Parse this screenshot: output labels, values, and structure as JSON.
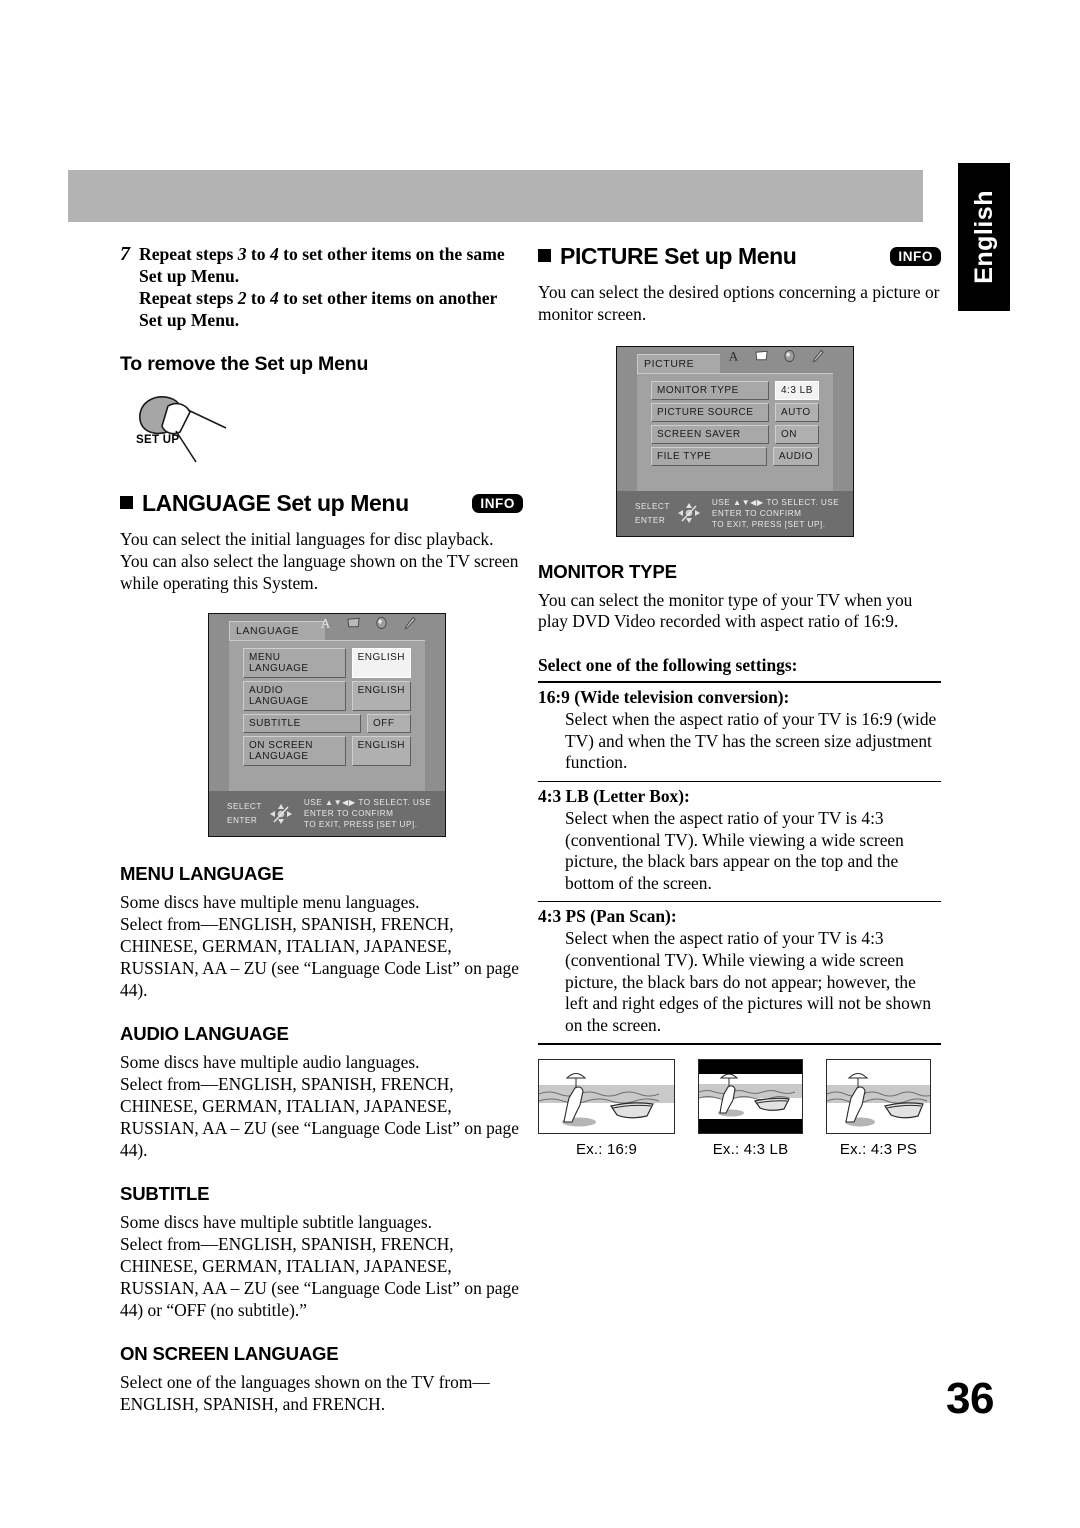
{
  "page": {
    "number": "36",
    "language_tab": "English"
  },
  "left": {
    "step7": {
      "num": "7",
      "line1_a": "Repeat steps ",
      "line1_n1": "3",
      "line1_b": " to ",
      "line1_n2": "4",
      "line1_c": " to set other items on the same Set up Menu.",
      "line2_a": "Repeat steps ",
      "line2_n1": "2",
      "line2_b": " to ",
      "line2_n2": "4",
      "line2_c": " to set other items on another Set up Menu."
    },
    "remove_heading": "To remove the Set up Menu",
    "setup_button_label": "SET UP",
    "language_section": {
      "title": "LANGUAGE Set up Menu",
      "info_badge": "INFO",
      "intro": "You can select the initial languages for disc playback. You can also select the language shown on the TV screen while operating this System."
    },
    "language_osd": {
      "tab_title": "LANGUAGE",
      "rows": [
        {
          "key": "MENU LANGUAGE",
          "value": "ENGLISH",
          "selected": true
        },
        {
          "key": "AUDIO LANGUAGE",
          "value": "ENGLISH",
          "selected": false
        },
        {
          "key": "SUBTITLE",
          "value": "OFF",
          "selected": false
        },
        {
          "key": "ON SCREEN LANGUAGE",
          "value": "ENGLISH",
          "selected": false
        }
      ],
      "footer": {
        "select_label": "SELECT",
        "enter_label": "ENTER",
        "line1": "USE ▲▼◀▶ TO SELECT.  USE ENTER TO CONFIRM",
        "line2": "TO EXIT, PRESS [SET UP]."
      },
      "active_tab_index": 0
    },
    "menu_language": {
      "heading": "MENU LANGUAGE",
      "line1": "Some discs have multiple menu languages.",
      "line2": "Select from—ENGLISH, SPANISH, FRENCH, CHINESE, GERMAN, ITALIAN, JAPANESE, RUSSIAN, AA – ZU (see “Language Code List” on page 44)."
    },
    "audio_language": {
      "heading": "AUDIO LANGUAGE",
      "line1": "Some discs have multiple audio languages.",
      "line2": "Select from—ENGLISH, SPANISH, FRENCH, CHINESE, GERMAN, ITALIAN, JAPANESE, RUSSIAN, AA – ZU (see “Language Code List” on page 44)."
    },
    "subtitle": {
      "heading": "SUBTITLE",
      "line1": "Some discs have multiple subtitle languages.",
      "line2": "Select from—ENGLISH, SPANISH, FRENCH, CHINESE, GERMAN, ITALIAN, JAPANESE, RUSSIAN, AA – ZU (see “Language Code List” on page 44) or “OFF (no subtitle).”"
    },
    "on_screen_language": {
      "heading": "ON SCREEN LANGUAGE",
      "line1": "Select one of the languages shown on the TV from—ENGLISH, SPANISH, and FRENCH."
    }
  },
  "right": {
    "picture_section": {
      "title": "PICTURE Set up Menu",
      "info_badge": "INFO",
      "intro": "You can select the desired options concerning a picture or monitor screen."
    },
    "picture_osd": {
      "tab_title": "PICTURE",
      "rows": [
        {
          "key": "MONITOR TYPE",
          "value": "4:3 LB",
          "selected": true
        },
        {
          "key": "PICTURE SOURCE",
          "value": "AUTO",
          "selected": false
        },
        {
          "key": "SCREEN SAVER",
          "value": "ON",
          "selected": false
        },
        {
          "key": "FILE TYPE",
          "value": "AUDIO",
          "selected": false
        }
      ],
      "footer": {
        "select_label": "SELECT",
        "enter_label": "ENTER",
        "line1": "USE ▲▼◀▶ TO SELECT.  USE ENTER TO CONFIRM",
        "line2": "TO EXIT, PRESS [SET UP]."
      },
      "active_tab_index": 1
    },
    "monitor_type": {
      "heading": "MONITOR TYPE",
      "intro": "You can select the monitor type of your TV when you play DVD Video recorded with aspect ratio of 16:9.",
      "settings_head": "Select one of the following settings:",
      "options": [
        {
          "title": "16:9 (Wide television conversion):",
          "desc": "Select when the aspect ratio of your TV is 16:9 (wide TV) and when the TV has the screen size adjustment function."
        },
        {
          "title": "4:3 LB (Letter Box):",
          "desc": "Select when the aspect ratio of your TV is 4:3 (conventional TV). While viewing a wide screen picture, the black bars appear on the top and the bottom of the screen."
        },
        {
          "title": "4:3 PS (Pan Scan):",
          "desc": "Select when the aspect ratio of your TV is 4:3 (conventional TV). While viewing a wide screen picture, the black bars do not appear; however, the left and right edges of the pictures will not be shown on the screen."
        }
      ]
    },
    "examples": [
      {
        "caption": "Ex.: 16:9",
        "mode": "wide"
      },
      {
        "caption": "Ex.: 4:3 LB",
        "mode": "letterbox"
      },
      {
        "caption": "Ex.: 4:3 PS",
        "mode": "panscan"
      }
    ]
  },
  "colors": {
    "header_bar": "#b3b3b3",
    "tab_background": "#000000",
    "osd_background": "#8e8e8e",
    "osd_panel": "#a2a2a2",
    "osd_footer": "#6e6e6e",
    "selected_value": "#f2f2f2"
  }
}
